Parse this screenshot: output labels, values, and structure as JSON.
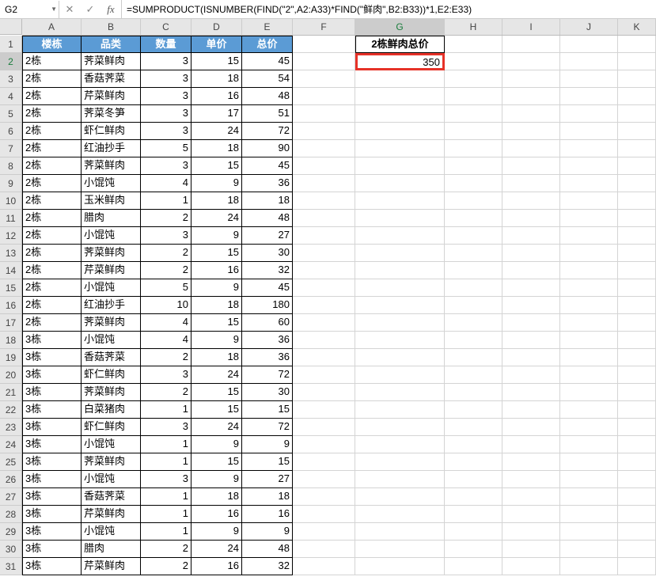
{
  "name_box": "G2",
  "formula": "=SUMPRODUCT(ISNUMBER(FIND(\"2\",A2:A33)*FIND(\"鲜肉\",B2:B33))*1,E2:E33)",
  "columns": [
    "A",
    "B",
    "C",
    "D",
    "E",
    "F",
    "G",
    "H",
    "I",
    "J",
    "K"
  ],
  "active_col": "G",
  "active_row": 2,
  "table_headers": [
    "楼栋",
    "品类",
    "数量",
    "单价",
    "总价"
  ],
  "g_header": "2栋鲜肉总价",
  "g_value": "350",
  "chart_data": {
    "type": "table",
    "columns": [
      "楼栋",
      "品类",
      "数量",
      "单价",
      "总价"
    ],
    "rows": [
      [
        "2栋",
        "荠菜鲜肉",
        3,
        15,
        45
      ],
      [
        "2栋",
        "香菇荠菜",
        3,
        18,
        54
      ],
      [
        "2栋",
        "芹菜鲜肉",
        3,
        16,
        48
      ],
      [
        "2栋",
        "荠菜冬笋",
        3,
        17,
        51
      ],
      [
        "2栋",
        "虾仁鲜肉",
        3,
        24,
        72
      ],
      [
        "2栋",
        "红油抄手",
        5,
        18,
        90
      ],
      [
        "2栋",
        "荠菜鲜肉",
        3,
        15,
        45
      ],
      [
        "2栋",
        "小馄饨",
        4,
        9,
        36
      ],
      [
        "2栋",
        "玉米鲜肉",
        1,
        18,
        18
      ],
      [
        "2栋",
        "腊肉",
        2,
        24,
        48
      ],
      [
        "2栋",
        "小馄饨",
        3,
        9,
        27
      ],
      [
        "2栋",
        "荠菜鲜肉",
        2,
        15,
        30
      ],
      [
        "2栋",
        "芹菜鲜肉",
        2,
        16,
        32
      ],
      [
        "2栋",
        "小馄饨",
        5,
        9,
        45
      ],
      [
        "2栋",
        "红油抄手",
        10,
        18,
        180
      ],
      [
        "2栋",
        "荠菜鲜肉",
        4,
        15,
        60
      ],
      [
        "3栋",
        "小馄饨",
        4,
        9,
        36
      ],
      [
        "3栋",
        "香菇荠菜",
        2,
        18,
        36
      ],
      [
        "3栋",
        "虾仁鲜肉",
        3,
        24,
        72
      ],
      [
        "3栋",
        "荠菜鲜肉",
        2,
        15,
        30
      ],
      [
        "3栋",
        "白菜猪肉",
        1,
        15,
        15
      ],
      [
        "3栋",
        "虾仁鲜肉",
        3,
        24,
        72
      ],
      [
        "3栋",
        "小馄饨",
        1,
        9,
        9
      ],
      [
        "3栋",
        "荠菜鲜肉",
        1,
        15,
        15
      ],
      [
        "3栋",
        "小馄饨",
        3,
        9,
        27
      ],
      [
        "3栋",
        "香菇荠菜",
        1,
        18,
        18
      ],
      [
        "3栋",
        "芹菜鲜肉",
        1,
        16,
        16
      ],
      [
        "3栋",
        "小馄饨",
        1,
        9,
        9
      ],
      [
        "3栋",
        "腊肉",
        2,
        24,
        48
      ],
      [
        "3栋",
        "芹菜鲜肉",
        2,
        16,
        32
      ]
    ]
  }
}
